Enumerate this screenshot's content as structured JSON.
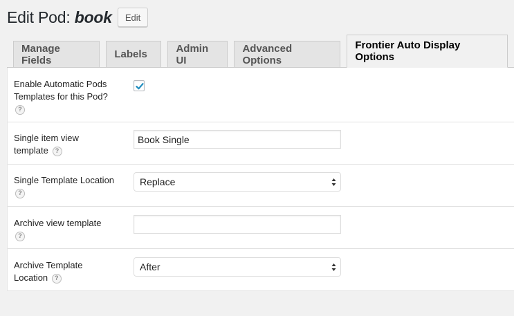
{
  "header": {
    "title_prefix": "Edit Pod: ",
    "pod_name": "book",
    "edit_label": "Edit"
  },
  "tabs": [
    {
      "label": "Manage Fields",
      "active": false
    },
    {
      "label": "Labels",
      "active": false
    },
    {
      "label": "Admin UI",
      "active": false
    },
    {
      "label": "Advanced Options",
      "active": false
    },
    {
      "label": "Frontier Auto Display Options",
      "active": true
    }
  ],
  "fields": {
    "enable_templates": {
      "label": "Enable Automatic Pods Templates for this Pod?",
      "checked": true,
      "help": "?"
    },
    "single_view": {
      "label": "Single item view template",
      "value": "Book Single",
      "placeholder": "",
      "help": "?"
    },
    "single_location": {
      "label": "Single Template Location",
      "selected": "Replace",
      "help": "?"
    },
    "archive_view": {
      "label": "Archive view template",
      "value": "",
      "placeholder": "",
      "help": "?"
    },
    "archive_location": {
      "label": "Archive Template Location",
      "selected": "After",
      "help": "?"
    }
  },
  "colors": {
    "checkmark": "#1e8cbe",
    "background": "#f1f1f1",
    "panel": "#ffffff"
  }
}
